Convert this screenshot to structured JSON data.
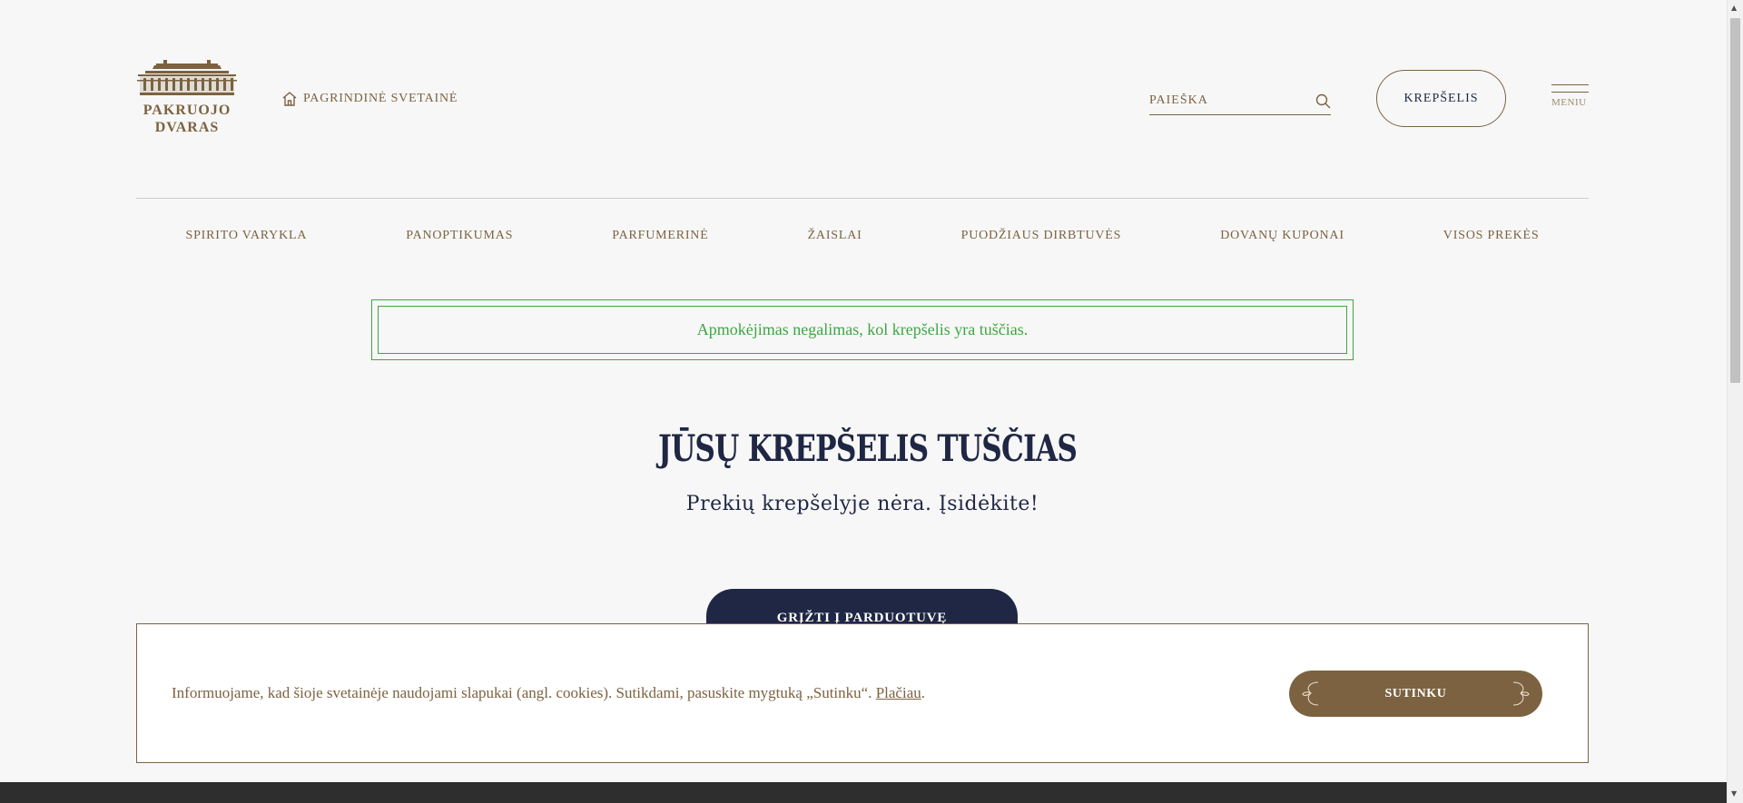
{
  "header": {
    "logo_text_line1": "PAKRUOJO",
    "logo_text_line2": "DVARAS",
    "home_link": "PAGRINDINĖ SVETAINĖ",
    "search_placeholder": "PAIEŠKA",
    "cart_label": "KREPŠELIS",
    "menu_label": "MENIU"
  },
  "nav": {
    "items": [
      "SPIRITO VARYKLA",
      "PANOPTIKUMAS",
      "PARFUMERINĖ",
      "ŽAISLAI",
      "PUODŽIAUS DIRBTUVĖS",
      "DOVANŲ KUPONAI",
      "VISOS PREKĖS"
    ]
  },
  "notice": {
    "message": "Apmokėjimas negalimas, kol krepšelis yra tuščias."
  },
  "cart": {
    "title": "JŪSŲ KREPŠELIS TUŠČIAS",
    "subtitle": "Prekių krepšelyje nėra. Įsidėkite!",
    "back_button": "GRĮŽTI Į PARDUOTUVĘ"
  },
  "cookie": {
    "text": "Informuojame, kad šioje svetainėje naudojami slapukai (angl. cookies). Sutikdami, pasuskite mygtuką „Sutinku“.",
    "link": "Plačiau",
    "after_link": ".",
    "accept_button": "SUTINKU"
  },
  "colors": {
    "brand_brown": "#7c6241",
    "navy": "#1f2744",
    "notice_green": "#3ea542",
    "background": "#f7f7f7"
  },
  "icons": {
    "home": "home-icon",
    "search": "search-icon",
    "menu": "hamburger-icon",
    "logo": "manor-house-logo"
  }
}
